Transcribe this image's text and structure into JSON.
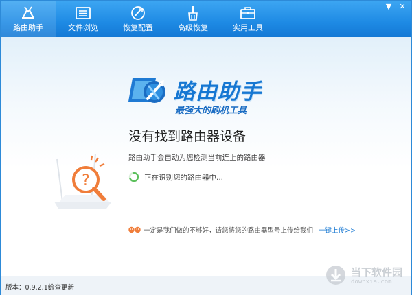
{
  "nav": {
    "items": [
      {
        "label": "路由助手",
        "icon": "router-tools-icon"
      },
      {
        "label": "文件浏览",
        "icon": "file-list-icon"
      },
      {
        "label": "恢复配置",
        "icon": "restore-icon"
      },
      {
        "label": "高级恢复",
        "icon": "brush-icon"
      },
      {
        "label": "实用工具",
        "icon": "toolbox-icon"
      }
    ],
    "active_index": 0
  },
  "window_controls": {
    "menu": "▼",
    "close": "✕"
  },
  "logo": {
    "title": "路由助手",
    "subtitle": "最强大的刷机工具"
  },
  "main": {
    "heading": "没有找到路由器设备",
    "description": "路由助手会自动为您检测当前连上的路由器",
    "status": "正在识别您的路由器中..."
  },
  "feedback": {
    "text": "一定是我们做的不够好，请您将您的路由器型号上传给我们",
    "link": "一键上传>>"
  },
  "footer": {
    "version": "版本：0.9.2.19",
    "update": "检查更新"
  },
  "watermark": {
    "title": "当下软件园",
    "sub": "downxia.com"
  },
  "colors": {
    "topbar": "#1e8ae4",
    "accent": "#1677d2",
    "spinner": "#5cc05c",
    "warning": "#f07d3a"
  }
}
